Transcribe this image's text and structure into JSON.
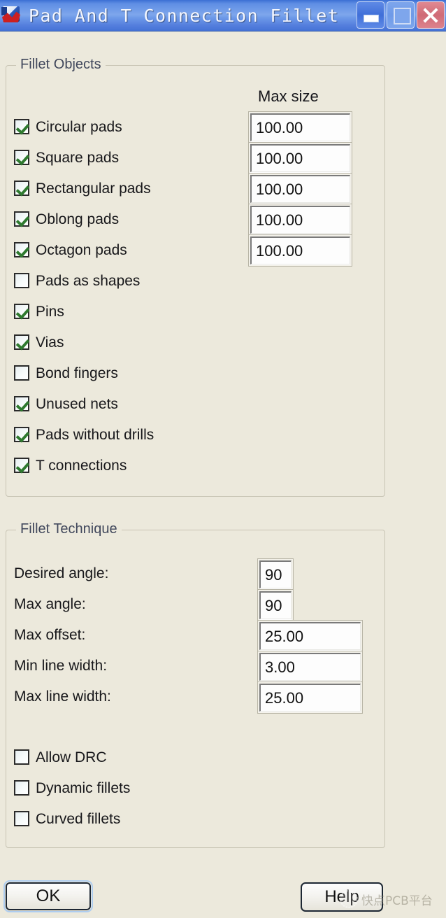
{
  "window": {
    "title": "Pad And T Connection Fillet",
    "icon": "app-icon",
    "buttons": {
      "minimize": "minimize-button",
      "maximize": "maximize-button",
      "close": "close-button"
    }
  },
  "fillet_objects": {
    "group_title": "Fillet Objects",
    "max_size_header": "Max size",
    "items": [
      {
        "label": "Circular pads",
        "checked": true,
        "max_size": "100.00"
      },
      {
        "label": "Square pads",
        "checked": true,
        "max_size": "100.00"
      },
      {
        "label": "Rectangular pads",
        "checked": true,
        "max_size": "100.00"
      },
      {
        "label": "Oblong pads",
        "checked": true,
        "max_size": "100.00"
      },
      {
        "label": "Octagon pads",
        "checked": true,
        "max_size": "100.00"
      },
      {
        "label": "Pads as shapes",
        "checked": false
      },
      {
        "label": "Pins",
        "checked": true
      },
      {
        "label": "Vias",
        "checked": true
      },
      {
        "label": "Bond fingers",
        "checked": false
      },
      {
        "label": "Unused nets",
        "checked": true
      },
      {
        "label": "Pads without drills",
        "checked": true
      },
      {
        "label": "T connections",
        "checked": true
      }
    ]
  },
  "fillet_technique": {
    "group_title": "Fillet Technique",
    "fields": [
      {
        "label": "Desired angle:",
        "value": "90"
      },
      {
        "label": "Max angle:",
        "value": "90"
      },
      {
        "label": "Max offset:",
        "value": "25.00"
      },
      {
        "label": "Min line width:",
        "value": "3.00"
      },
      {
        "label": "Max line width:",
        "value": "25.00"
      }
    ],
    "options": [
      {
        "label": "Allow DRC",
        "checked": false
      },
      {
        "label": "Dynamic fillets",
        "checked": false
      },
      {
        "label": "Curved fillets",
        "checked": false
      }
    ]
  },
  "footer": {
    "ok_label": "OK",
    "help_label": "Help"
  },
  "watermark": {
    "text": "快点PCB平台"
  },
  "colors": {
    "dialog_bg": "#ece9dc",
    "titlebar_blue": "#5f8ee4",
    "group_border": "#c8c4b4",
    "check_green": "#2f7a2f",
    "title_text": "#f4f7ff"
  }
}
